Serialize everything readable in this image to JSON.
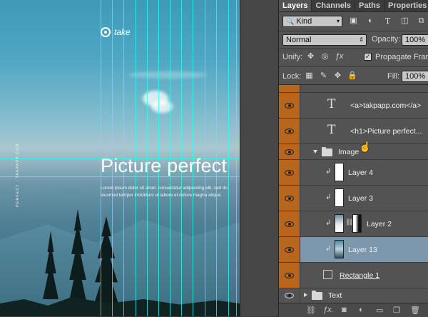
{
  "canvas": {
    "logo_text": "take",
    "headline": "Picture perfect",
    "body": "Lorem ipsum dolor sit amet, consectetur adipisicing elit, sed do eiusmod tempor incididunt ut labore et dolore magna aliqua.",
    "vertical_text": "PERFECT · TAKPAPP.COM"
  },
  "panel": {
    "tabs": [
      "Layers",
      "Channels",
      "Paths",
      "Properties"
    ],
    "kind_filter": "Kind",
    "blend_mode": "Normal",
    "opacity_label": "Opacity:",
    "opacity_value": "100%",
    "unify_label": "Unify:",
    "propagate_label": "Propagate Frame",
    "lock_label": "Lock:",
    "fill_label": "Fill:",
    "fill_value": "100%"
  },
  "layers": [
    {
      "name": "<a>takpapp.com</a>",
      "type": "text"
    },
    {
      "name": "<h1>Picture perfect...",
      "type": "text"
    },
    {
      "name": "Image",
      "type": "group"
    },
    {
      "name": "Layer 4",
      "type": "pixel"
    },
    {
      "name": "Layer 3",
      "type": "pixel"
    },
    {
      "name": "Layer 2",
      "type": "pixel-mask"
    },
    {
      "name": "Layer 13",
      "type": "pixel",
      "selected": true
    },
    {
      "name": "Rectangle 1",
      "type": "shape"
    },
    {
      "name": "Text",
      "type": "group"
    }
  ],
  "colors": {
    "eye_column": "#b8661b",
    "selection": "#7d97ad",
    "guide": "#28ffff"
  }
}
